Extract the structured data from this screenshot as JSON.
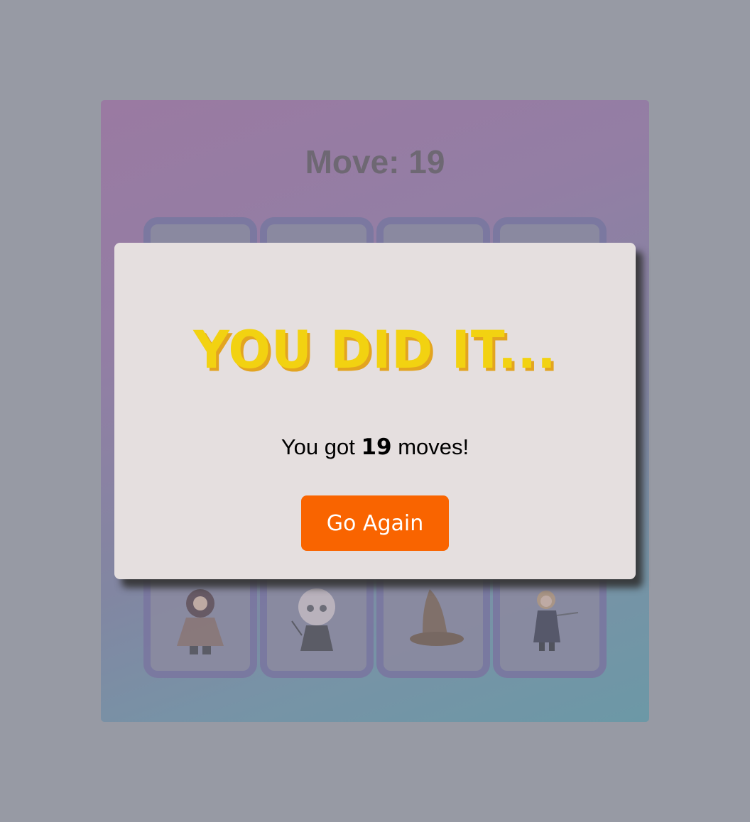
{
  "board": {
    "moves_label": "Move: 19"
  },
  "cards": [
    "hidden",
    "hidden",
    "hidden",
    "hidden",
    "hidden",
    "hidden",
    "hidden",
    "hidden",
    "hidden",
    "hidden",
    "hidden",
    "hidden",
    "hagrid",
    "voldemort",
    "sorting-hat",
    "hermione"
  ],
  "modal": {
    "title": "YOU DID IT...",
    "msg_prefix": "You got ",
    "msg_count": "19",
    "msg_suffix": " moves!",
    "button": "Go Again"
  },
  "colors": {
    "accent": "#f96400",
    "title": "#f2d211",
    "title_shadow": "#e3a420",
    "modal_bg": "#e5dfdf"
  }
}
